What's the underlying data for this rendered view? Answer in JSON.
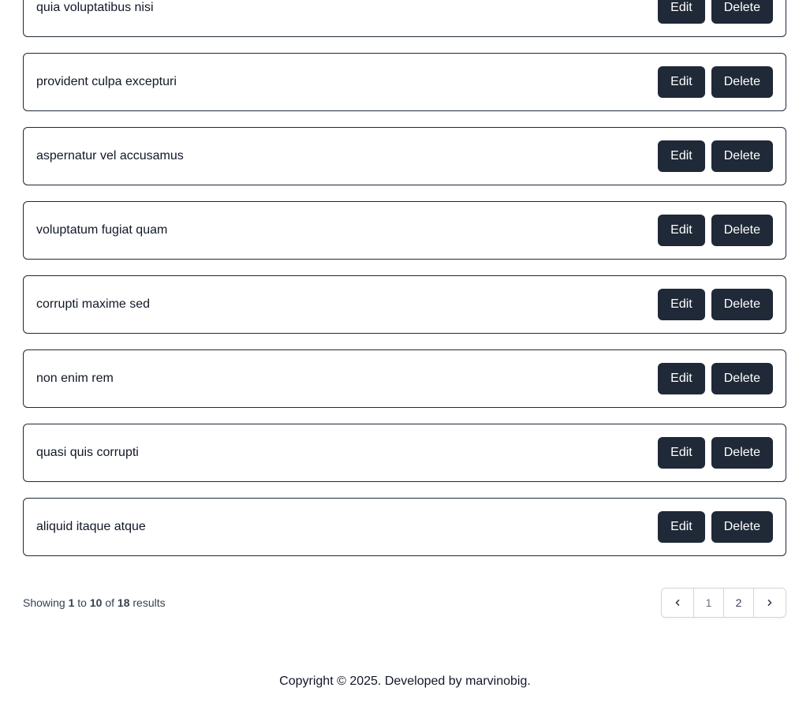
{
  "items": [
    {
      "title": "quia voluptatibus nisi",
      "edit_label": "Edit",
      "delete_label": "Delete"
    },
    {
      "title": "provident culpa excepturi",
      "edit_label": "Edit",
      "delete_label": "Delete"
    },
    {
      "title": "aspernatur vel accusamus",
      "edit_label": "Edit",
      "delete_label": "Delete"
    },
    {
      "title": "voluptatum fugiat quam",
      "edit_label": "Edit",
      "delete_label": "Delete"
    },
    {
      "title": "corrupti maxime sed",
      "edit_label": "Edit",
      "delete_label": "Delete"
    },
    {
      "title": "non enim rem",
      "edit_label": "Edit",
      "delete_label": "Delete"
    },
    {
      "title": "quasi quis corrupti",
      "edit_label": "Edit",
      "delete_label": "Delete"
    },
    {
      "title": "aliquid itaque atque",
      "edit_label": "Edit",
      "delete_label": "Delete"
    }
  ],
  "pagination": {
    "showing_label": "Showing",
    "from": "1",
    "to_label": "to",
    "to": "10",
    "of_label": "of",
    "total": "18",
    "results_label": "results",
    "pages": [
      "1",
      "2"
    ],
    "current_page": "1",
    "prev_icon": "chevron-left-icon",
    "next_icon": "chevron-right-icon"
  },
  "footer": {
    "text": "Copyright © 2025. Developed by marvinobig."
  },
  "colors": {
    "button_bg": "#1f2937",
    "button_text": "#ffffff",
    "border": "#1f2937"
  }
}
